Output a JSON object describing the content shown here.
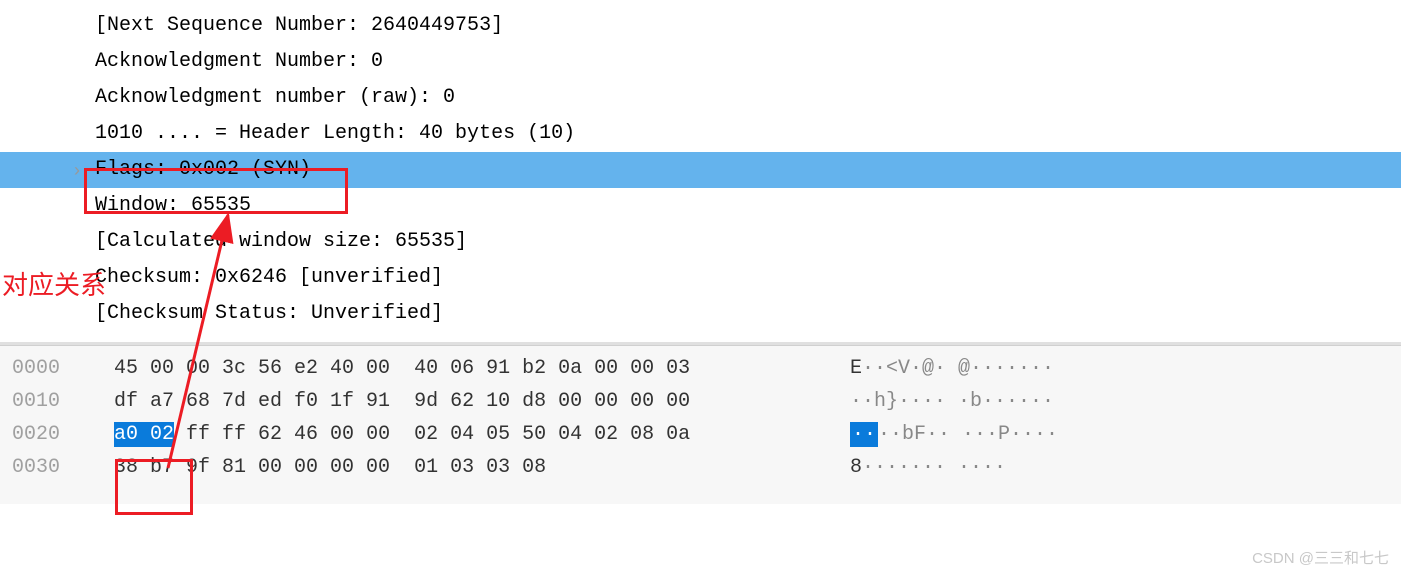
{
  "details": {
    "next_seq": "[Next Sequence Number: 2640449753]",
    "ack_num": "Acknowledgment Number: 0",
    "ack_num_raw": "Acknowledgment number (raw): 0",
    "header_len": "1010 .... = Header Length: 40 bytes (10)",
    "flags": "Flags: 0x002 (SYN)",
    "window": "Window: 65535",
    "calc_win": "[Calculated window size: 65535]",
    "checksum": "Checksum: 0x6246 [unverified]",
    "checksum_status": "[Checksum Status: Unverified]"
  },
  "hex": {
    "rows": [
      {
        "offset": "0000",
        "bytes_before": "45 00 00 3c 56 e2 40 00  40 06 91 b2 0a 00 00 03",
        "bytes_hl": "",
        "bytes_after": "",
        "ascii_before": "E",
        "ascii_mid": "··<V·@· @·······",
        "ascii_hl": "",
        "ascii_after": ""
      },
      {
        "offset": "0010",
        "bytes_before": "df a7 68 7d ed f0 1f 91  9d 62 10 d8 00 00 00 00",
        "bytes_hl": "",
        "bytes_after": "",
        "ascii_before": "··h}···· ·b······",
        "ascii_mid": "",
        "ascii_hl": "",
        "ascii_after": ""
      },
      {
        "offset": "0020",
        "bytes_before": "",
        "bytes_hl": "a0 02",
        "bytes_after": " ff ff 62 46 00 00  02 04 05 50 04 02 08 0a",
        "ascii_before": "",
        "ascii_mid": "",
        "ascii_hl": "··",
        "ascii_after": "··bF·· ···P····"
      },
      {
        "offset": "0030",
        "bytes_before": "38 b7 9f 81 00 00 00 00  01 03 03 08",
        "bytes_hl": "",
        "bytes_after": "",
        "ascii_before": "8······· ····",
        "ascii_mid": "",
        "ascii_hl": "",
        "ascii_after": ""
      }
    ]
  },
  "annotation": "对应关系",
  "watermark": "CSDN @三三和七七"
}
